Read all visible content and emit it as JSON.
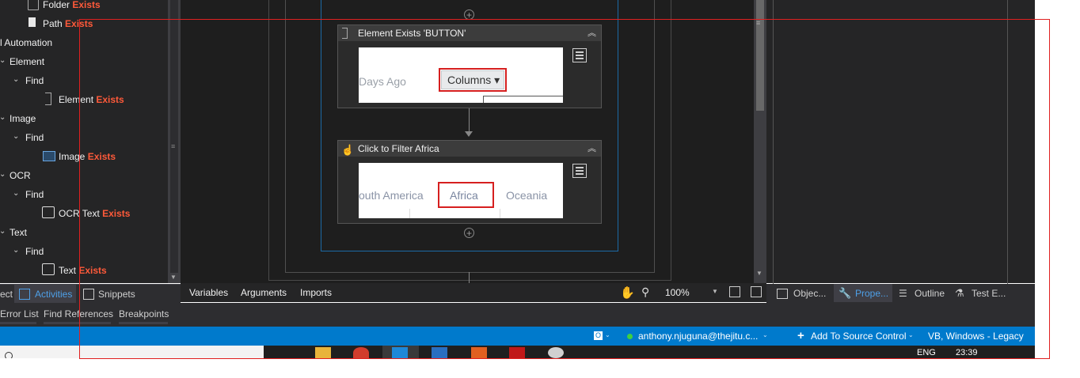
{
  "activities_tree": {
    "items": [
      {
        "label": "Folder ",
        "highlight": "Exists"
      },
      {
        "label": "Path ",
        "highlight": "Exists"
      },
      {
        "label": "l Automation",
        "highlight": ""
      },
      {
        "label": "Element",
        "highlight": ""
      },
      {
        "label": "Find",
        "highlight": ""
      },
      {
        "label": "Element ",
        "highlight": "Exists"
      },
      {
        "label": "Image",
        "highlight": ""
      },
      {
        "label": "Find",
        "highlight": ""
      },
      {
        "label": "Image ",
        "highlight": "Exists"
      },
      {
        "label": "OCR",
        "highlight": ""
      },
      {
        "label": "Find",
        "highlight": ""
      },
      {
        "label": "OCR Text ",
        "highlight": "Exists"
      },
      {
        "label": "Text",
        "highlight": ""
      },
      {
        "label": "Find",
        "highlight": ""
      },
      {
        "label": "Text ",
        "highlight": "Exists"
      }
    ]
  },
  "left_tabs": {
    "project": "ect",
    "activities": "Activities",
    "snippets": "Snippets"
  },
  "designer": {
    "activity1": {
      "title": "Element Exists 'BUTTON'",
      "shot_left": "Days Ago",
      "shot_button": "Columns ▾"
    },
    "activity2": {
      "title": "Click to Filter Africa",
      "shot_left": "outh America",
      "shot_center": "Africa",
      "shot_right": "Oceania"
    },
    "tabs": {
      "variables": "Variables",
      "arguments": "Arguments",
      "imports": "Imports"
    },
    "zoom": "100%"
  },
  "right_tabs": {
    "object": "Objec...",
    "properties": "Prope...",
    "outline": "Outline",
    "test": "Test E..."
  },
  "output_tabs": {
    "error_list": "Error List",
    "find_references": "Find References",
    "breakpoints": "Breakpoints"
  },
  "status_bar": {
    "user": "anthony.njuguna@thejitu.c...",
    "source_control": "Add To Source Control",
    "language": "VB, Windows - Legacy"
  },
  "taskbar": {
    "lang": "ENG",
    "time": "23:39"
  },
  "colors": {
    "accent": "#007acc",
    "highlight": "#ff5a3a",
    "overlay": "#e02020"
  }
}
